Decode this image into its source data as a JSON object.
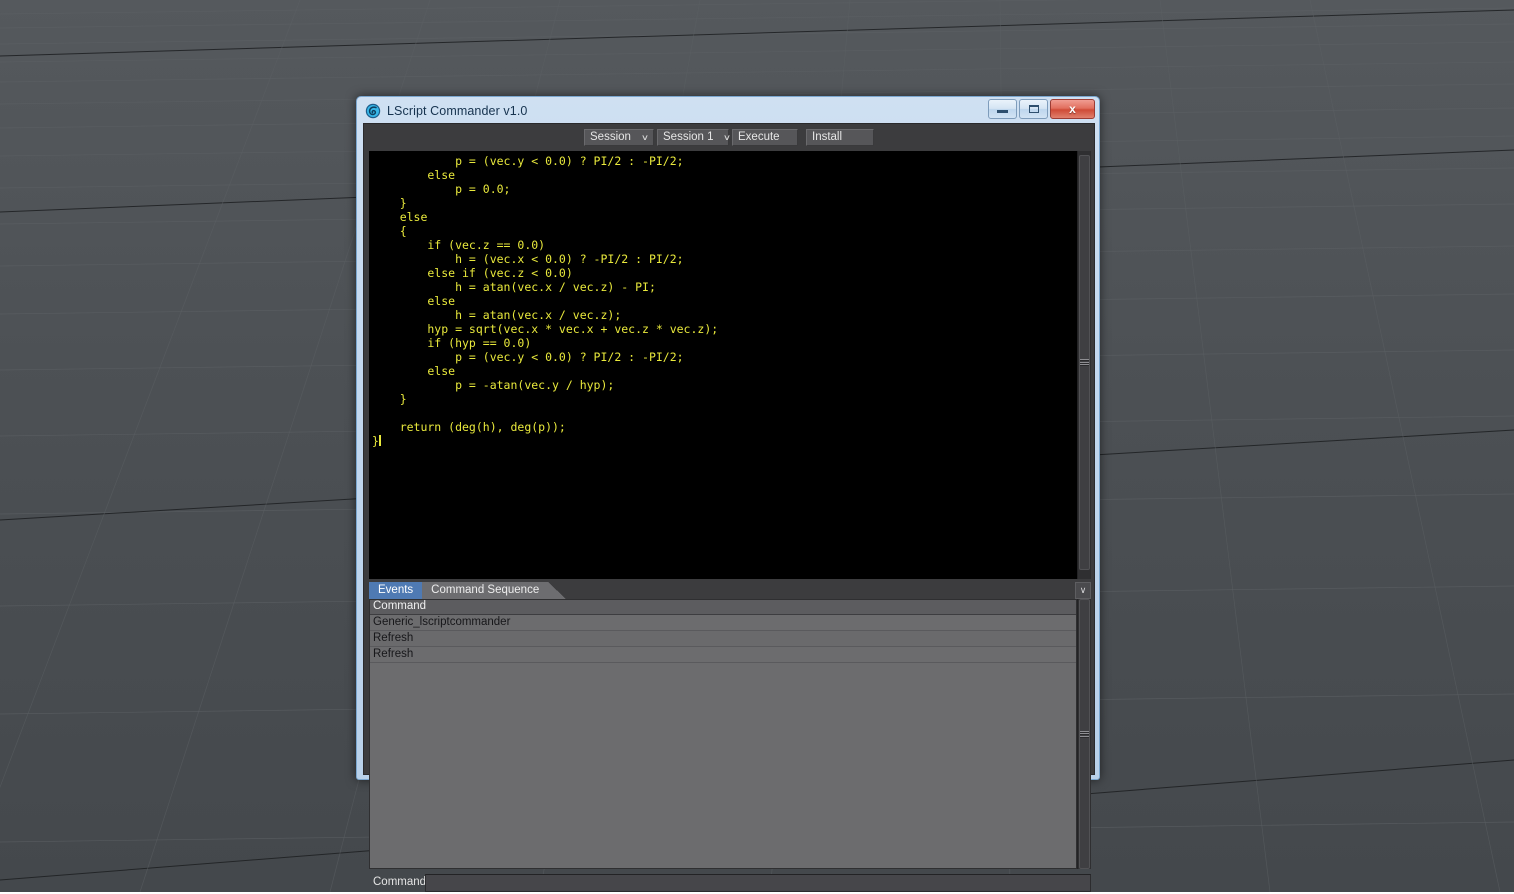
{
  "window": {
    "title": "LScript Commander v1.0",
    "icon": "lightwave-swirl-icon",
    "minimize_label": "",
    "maximize_label": "",
    "close_label": "x"
  },
  "toolbar": {
    "session_select": "Session",
    "session_number_select": "Session 1",
    "execute_label": "Execute",
    "install_label": "Install",
    "caret": "∨"
  },
  "editor": {
    "language": "lscript",
    "text_color": "#e9e93c",
    "background": "#000000",
    "code": "            p = (vec.y < 0.0) ? PI/2 : -PI/2;\n        else\n            p = 0.0;\n    }\n    else\n    {\n        if (vec.z == 0.0)\n            h = (vec.x < 0.0) ? -PI/2 : PI/2;\n        else if (vec.z < 0.0)\n            h = atan(vec.x / vec.z) - PI;\n        else\n            h = atan(vec.x / vec.z);\n        hyp = sqrt(vec.x * vec.x + vec.z * vec.z);\n        if (hyp == 0.0)\n            p = (vec.y < 0.0) ? PI/2 : -PI/2;\n        else\n            p = -atan(vec.y / hyp);\n    }\n\n    return (deg(h), deg(p));\n}",
    "scrollbar": {
      "thumb_top_pct": 1,
      "thumb_height_pct": 97
    }
  },
  "tabs": {
    "items": [
      {
        "label": "Events",
        "active": true
      },
      {
        "label": "Command Sequence",
        "active": false
      }
    ],
    "collapse_caret": "∨"
  },
  "event_list": {
    "columns": [
      "Command"
    ],
    "rows": [
      {
        "command": "Generic_lscriptcommander"
      },
      {
        "command": "Refresh"
      },
      {
        "command": "Refresh"
      }
    ],
    "scrollbar": {
      "thumb_top_pct": 0,
      "thumb_height_pct": 100
    }
  },
  "command_bar": {
    "label": "Command",
    "value": "",
    "placeholder": ""
  },
  "colors": {
    "accent_tab": "#4f7ab3",
    "window_frame": "#c3d8ef",
    "client_bg": "#3c3c3e",
    "list_bg": "#6c6c6e",
    "code_text": "#e9e93c",
    "close_button": "#cf4b37"
  }
}
